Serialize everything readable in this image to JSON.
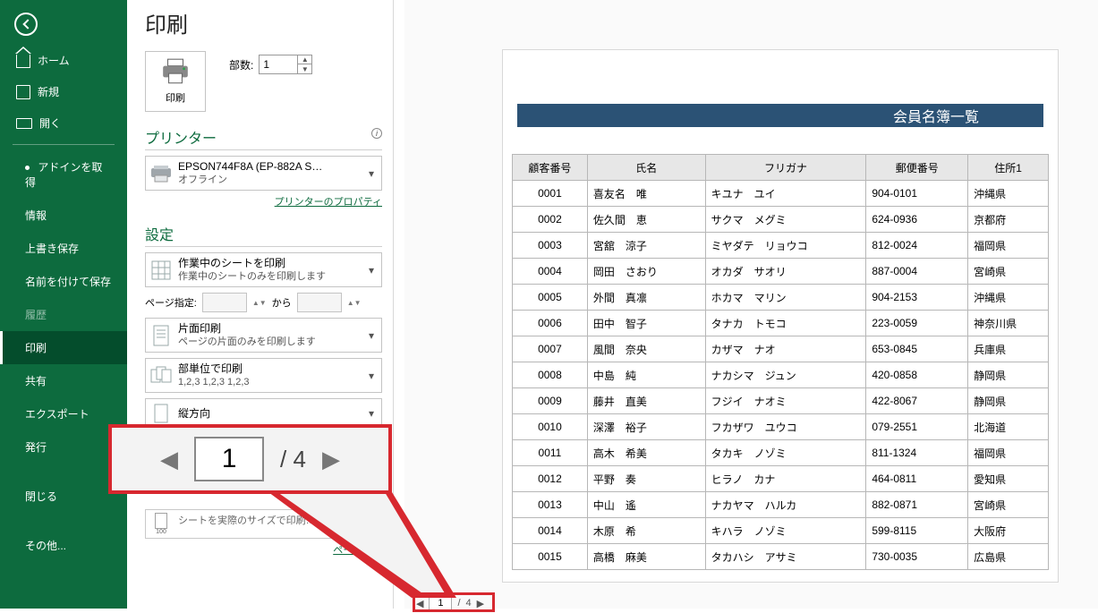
{
  "sidebar": {
    "items": [
      {
        "label": "ホーム"
      },
      {
        "label": "新規"
      },
      {
        "label": "開く"
      },
      {
        "label": "アドインを取得"
      },
      {
        "label": "情報"
      },
      {
        "label": "上書き保存"
      },
      {
        "label": "名前を付けて保存"
      },
      {
        "label": "履歴"
      },
      {
        "label": "印刷"
      },
      {
        "label": "共有"
      },
      {
        "label": "エクスポート"
      },
      {
        "label": "発行"
      },
      {
        "label": "閉じる"
      },
      {
        "label": "その他..."
      }
    ]
  },
  "main": {
    "title": "印刷",
    "print_btn": "印刷",
    "copies_label": "部数:",
    "copies_value": "1",
    "printer_section": "プリンター",
    "printer_name": "EPSON744F8A (EP-882A S…",
    "printer_status": "オフライン",
    "printer_props": "プリンターのプロパティ",
    "settings_section": "設定",
    "sheet_print_l1": "作業中のシートを印刷",
    "sheet_print_l2": "作業中のシートのみを印刷します",
    "page_label": "ページ指定:",
    "page_from_to": "から",
    "side_l1": "片面印刷",
    "side_l2": "ページの片面のみを印刷します",
    "collate_l1": "部単位で印刷",
    "collate_l2": "1,2,3   1,2,3   1,2,3",
    "orient": "縦方向",
    "scale_l2": "シートを実際のサイズで印刷…",
    "page_setup": "ページ設…"
  },
  "callout": {
    "current": "1",
    "total": "4",
    "sep": "/"
  },
  "pager": {
    "current": "1",
    "sep": "/",
    "total": "4"
  },
  "preview": {
    "title": "会員名簿一覧",
    "headers": [
      "顧客番号",
      "氏名",
      "フリガナ",
      "郵便番号",
      "住所1"
    ],
    "rows": [
      [
        "0001",
        "喜友名　唯",
        "キユナ　ユイ",
        "904-0101",
        "沖縄県"
      ],
      [
        "0002",
        "佐久間　恵",
        "サクマ　メグミ",
        "624-0936",
        "京都府"
      ],
      [
        "0003",
        "宮舘　涼子",
        "ミヤダテ　リョウコ",
        "812-0024",
        "福岡県"
      ],
      [
        "0004",
        "岡田　さおり",
        "オカダ　サオリ",
        "887-0004",
        "宮崎県"
      ],
      [
        "0005",
        "外間　真凛",
        "ホカマ　マリン",
        "904-2153",
        "沖縄県"
      ],
      [
        "0006",
        "田中　智子",
        "タナカ　トモコ",
        "223-0059",
        "神奈川県"
      ],
      [
        "0007",
        "風間　奈央",
        "カザマ　ナオ",
        "653-0845",
        "兵庫県"
      ],
      [
        "0008",
        "中島　純",
        "ナカシマ　ジュン",
        "420-0858",
        "静岡県"
      ],
      [
        "0009",
        "藤井　直美",
        "フジイ　ナオミ",
        "422-8067",
        "静岡県"
      ],
      [
        "0010",
        "深澤　裕子",
        "フカザワ　ユウコ",
        "079-2551",
        "北海道"
      ],
      [
        "0011",
        "高木　希美",
        "タカキ　ノゾミ",
        "811-1324",
        "福岡県"
      ],
      [
        "0012",
        "平野　奏",
        "ヒラノ　カナ",
        "464-0811",
        "愛知県"
      ],
      [
        "0013",
        "中山　遙",
        "ナカヤマ　ハルカ",
        "882-0871",
        "宮崎県"
      ],
      [
        "0014",
        "木原　希",
        "キハラ　ノゾミ",
        "599-8115",
        "大阪府"
      ],
      [
        "0015",
        "高橋　麻美",
        "タカハシ　アサミ",
        "730-0035",
        "広島県"
      ]
    ]
  }
}
